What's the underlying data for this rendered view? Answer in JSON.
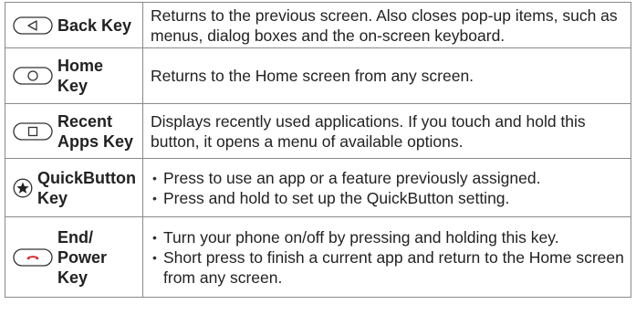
{
  "rows": [
    {
      "icon": "back-button-icon",
      "key_label": "Back Key",
      "description": "Returns to the previous screen. Also closes pop-up items, such as menus, dialog boxes and the on-screen keyboard."
    },
    {
      "icon": "home-button-icon",
      "key_label_line1": "Home",
      "key_label_line2": "Key",
      "description": "Returns to the Home screen from any screen."
    },
    {
      "icon": "recent-apps-button-icon",
      "key_label_line1": "Recent",
      "key_label_line2": "Apps Key",
      "description": "Displays recently used applications. If you touch and hold this button, it opens a menu of available options."
    },
    {
      "icon": "quickbutton-star-icon",
      "key_label_line1": "QuickButton",
      "key_label_line2": "Key",
      "bullets": [
        "Press to use an app or a feature previously assigned.",
        "Press and hold to set up the QuickButton setting."
      ]
    },
    {
      "icon": "end-power-button-icon",
      "key_label_line1": "End/",
      "key_label_line2": "Power",
      "key_label_line3": "Key",
      "bullets": [
        "Turn your phone on/off by pressing and holding this key.",
        "Short press to finish a current app and return to the Home screen from any screen."
      ]
    }
  ],
  "colors": {
    "border": "#8a8a8a",
    "text": "#222222",
    "end_key_red": "#d8262a"
  }
}
